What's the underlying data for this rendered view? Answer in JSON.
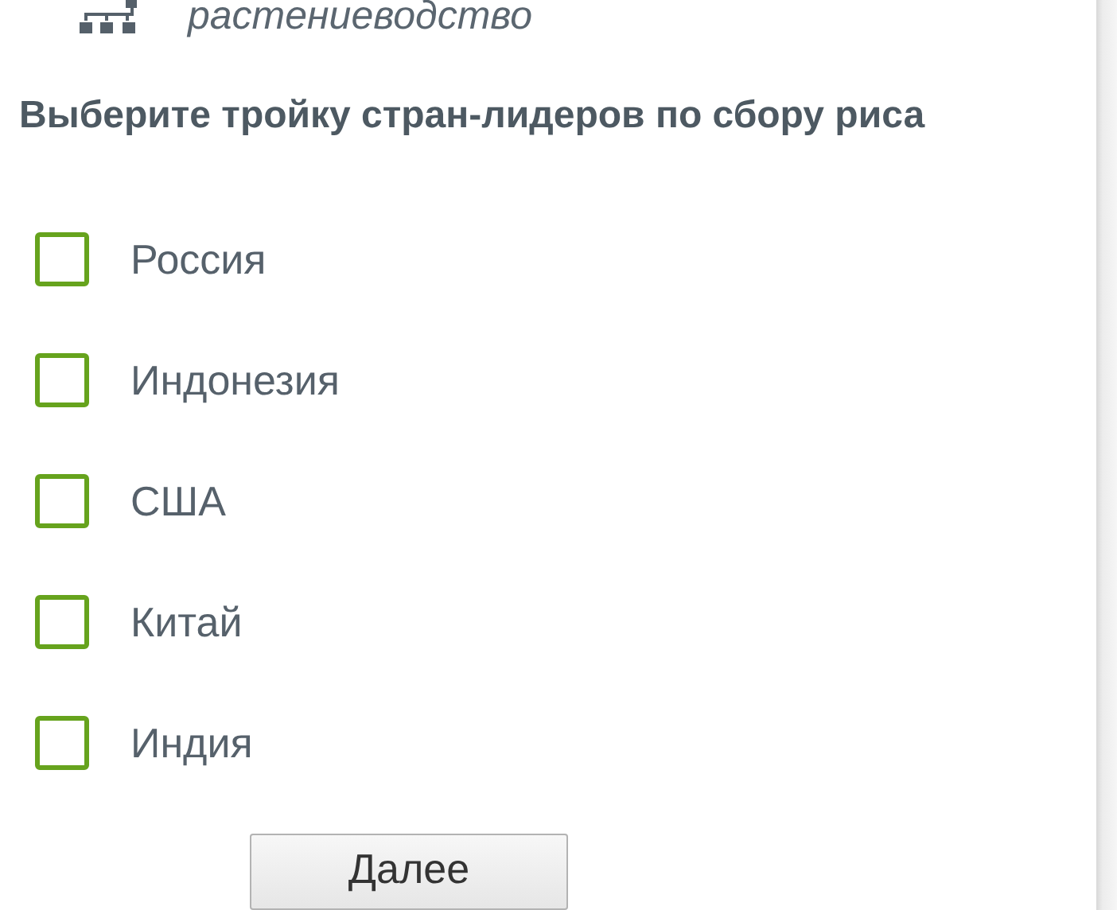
{
  "category": {
    "label": "растениеводство"
  },
  "question": "Выберите тройку стран-лидеров по сбору риса",
  "options": [
    {
      "label": "Россия",
      "checked": false
    },
    {
      "label": "Индонезия",
      "checked": false
    },
    {
      "label": "США",
      "checked": false
    },
    {
      "label": "Китай",
      "checked": false
    },
    {
      "label": "Индия",
      "checked": false
    }
  ],
  "next_button": "Далее"
}
